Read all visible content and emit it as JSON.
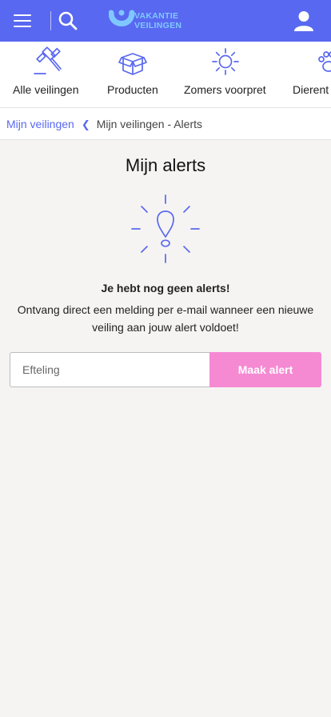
{
  "header": {
    "logo_line1": "VAKANTIE",
    "logo_line2": "VEILINGEN",
    "brand_color": "#5968f0",
    "icons": [
      "hamburger-menu-icon",
      "search-icon",
      "user-icon"
    ]
  },
  "categories": [
    {
      "label": "Alle veilingen",
      "icon": "gavel-icon"
    },
    {
      "label": "Producten",
      "icon": "box-icon"
    },
    {
      "label": "Zomers voorpret",
      "icon": "sun-icon"
    },
    {
      "label": "Dierent",
      "icon": "paw-icon"
    }
  ],
  "breadcrumb": {
    "parent": "Mijn veilingen",
    "current": "Mijn veilingen - Alerts"
  },
  "main": {
    "title": "Mijn alerts",
    "empty_title": "Je hebt nog geen alerts!",
    "empty_description": "Ontvang direct een melding per e-mail wanneer een nieuwe veiling aan jouw alert voldoet!"
  },
  "alert_form": {
    "input_placeholder": "Efteling",
    "input_value": "",
    "button_label": "Maak alert",
    "button_color": "#f58ad3"
  }
}
